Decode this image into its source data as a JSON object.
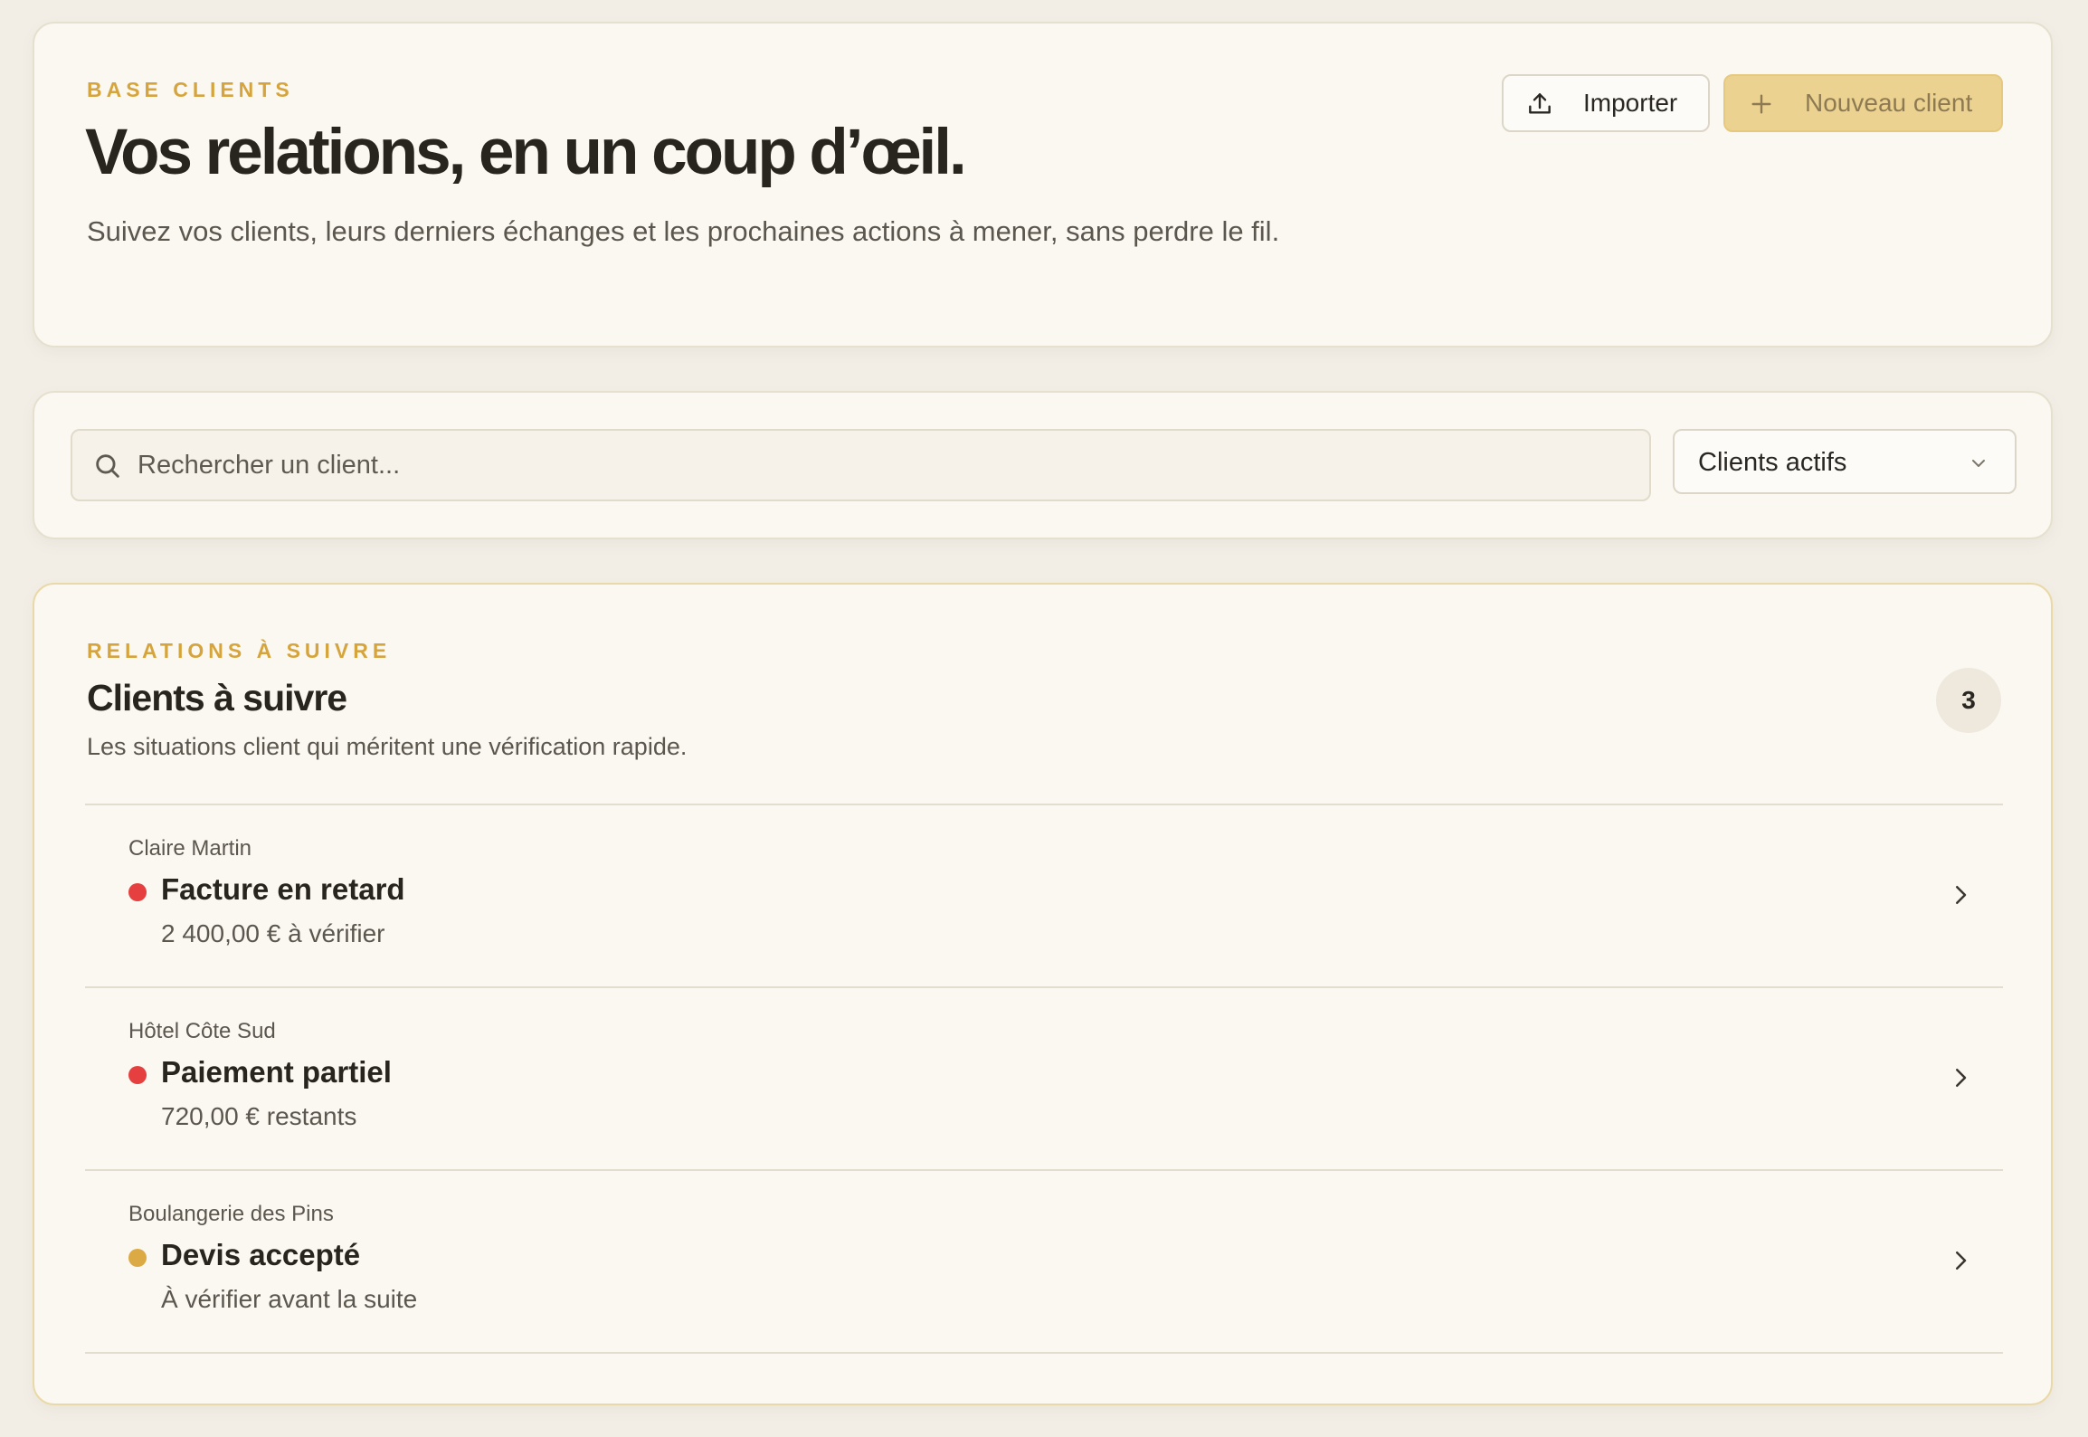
{
  "header": {
    "eyebrow": "BASE CLIENTS",
    "title": "Vos relations, en un coup d’œil.",
    "description": "Suivez vos clients, leurs derniers échanges et les prochaines actions à mener, sans perdre le fil.",
    "import_label": "Importer",
    "import_icon": "upload-icon",
    "new_client_label": "Nouveau client",
    "new_client_icon": "plus-icon"
  },
  "search": {
    "placeholder": "Rechercher un client...",
    "icon": "search-icon",
    "filter_selected": "Clients actifs",
    "filter_icon": "chevron-down-icon"
  },
  "followup": {
    "eyebrow": "RELATIONS À SUIVRE",
    "title": "Clients à suivre",
    "description": "Les situations client qui méritent une vérification rapide.",
    "count": "3",
    "items": [
      {
        "client": "Claire Martin",
        "status": "Facture en retard",
        "detail": "2 400,00 € à vérifier",
        "dot_color": "#e5403f"
      },
      {
        "client": "Hôtel Côte Sud",
        "status": "Paiement partiel",
        "detail": "720,00 € restants",
        "dot_color": "#e5403f"
      },
      {
        "client": "Boulangerie des Pins",
        "status": "Devis accepté",
        "detail": "À vérifier avant la suite",
        "dot_color": "#dcaa45"
      }
    ]
  },
  "colors": {
    "accent": "#d6a43c",
    "primary_button": "#ecd291",
    "background": "#f2eee6",
    "card": "#fbf8f2"
  }
}
